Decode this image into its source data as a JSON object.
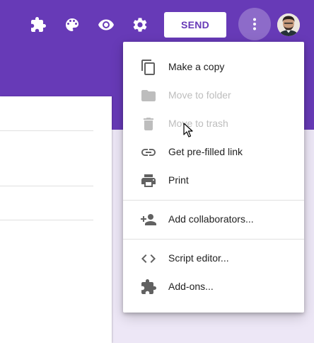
{
  "header": {
    "accent_color": "#673ab7",
    "icons": [
      "puzzle-icon",
      "palette-icon",
      "eye-icon",
      "gear-icon",
      "more-vert-icon"
    ],
    "send_label": "SEND"
  },
  "menu": {
    "items": [
      {
        "label": "Make a copy",
        "icon": "copy-icon",
        "enabled": true
      },
      {
        "label": "Move to folder",
        "icon": "folder-icon",
        "enabled": false
      },
      {
        "label": "Move to trash",
        "icon": "trash-icon",
        "enabled": false
      },
      {
        "label": "Get pre-filled link",
        "icon": "link-icon",
        "enabled": true
      },
      {
        "label": "Print",
        "icon": "printer-icon",
        "enabled": true
      },
      {
        "label": "Add collaborators...",
        "icon": "add-people-icon",
        "enabled": true
      },
      {
        "label": "Script editor...",
        "icon": "code-icon",
        "enabled": true
      },
      {
        "label": "Add-ons...",
        "icon": "puzzle-icon",
        "enabled": true
      }
    ]
  }
}
